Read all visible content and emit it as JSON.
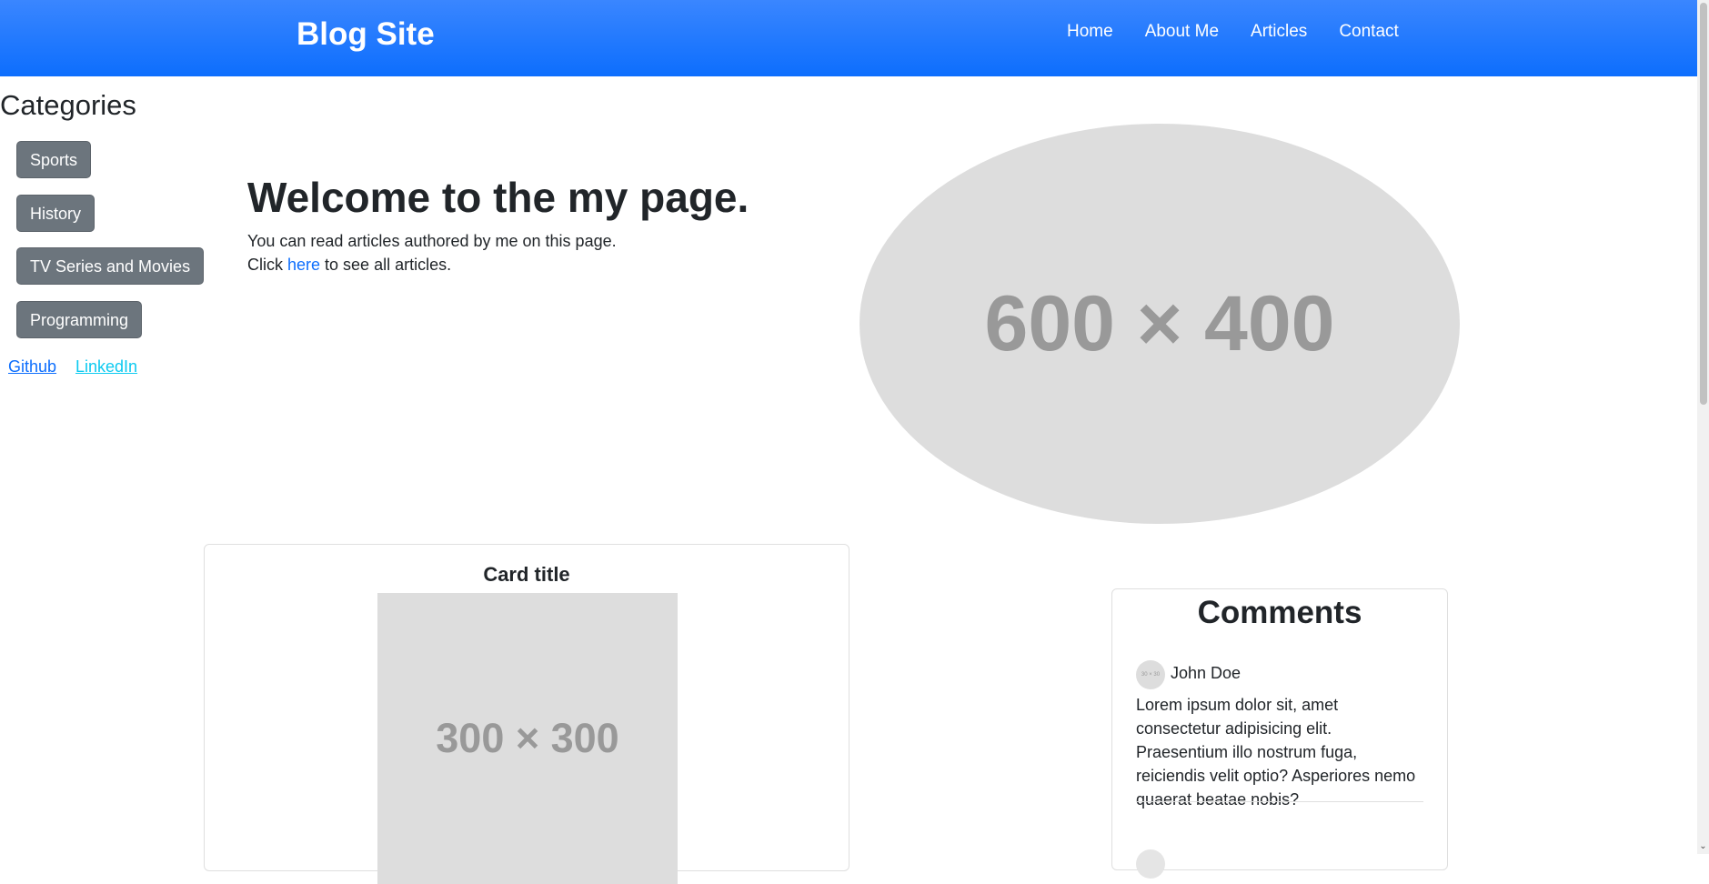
{
  "navbar": {
    "brand": "Blog Site",
    "links": [
      "Home",
      "About Me",
      "Articles",
      "Contact"
    ]
  },
  "sidebar": {
    "title": "Categories",
    "categories": [
      "Sports",
      "History",
      "TV Series and Movies",
      "Programming"
    ],
    "social": [
      "Github",
      "LinkedIn"
    ]
  },
  "hero": {
    "heading": "Welcome to the my page.",
    "line1": "You can read articles authored by me on this page.",
    "line2_before": "Click ",
    "line2_link": "here",
    "line2_after": " to see all articles.",
    "image_placeholder": "600 × 400"
  },
  "card": {
    "title": "Card title",
    "image_placeholder": "300 × 300"
  },
  "comments": {
    "title": "Comments",
    "items": [
      {
        "avatar_placeholder": "30 × 30",
        "author": "John Doe",
        "text": "Lorem ipsum dolor sit, amet consectetur adipisicing elit. Praesentium illo nostrum fuga, reiciendis velit optio? Asperiores nemo quaerat beatae nobis?"
      }
    ]
  },
  "colors": {
    "navbar": "#0d6efd",
    "category_button": "#6c757d",
    "link": "#0d6efd",
    "linkedin": "#0dcaf0",
    "placeholder": "#dddddd"
  }
}
